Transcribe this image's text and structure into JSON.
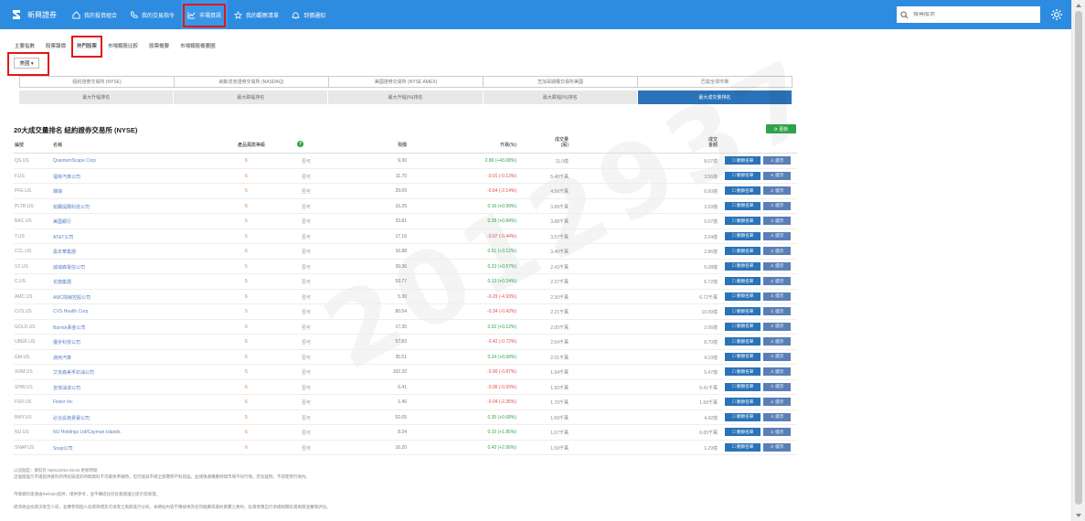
{
  "app": {
    "logo_label": "新興證券"
  },
  "nav": [
    {
      "label": "新興證券",
      "icon": "logo-icon"
    },
    {
      "label": "我的投資組合",
      "icon": "house-icon"
    },
    {
      "label": "我的交易指令",
      "icon": "phone-icon"
    },
    {
      "label": "市場資訊",
      "icon": "chart-icon"
    },
    {
      "label": "我的觀察清單",
      "icon": "star-icon"
    },
    {
      "label": "到價通知",
      "icon": "bell-icon"
    }
  ],
  "search": {
    "placeholder": "搜尋股票"
  },
  "subtabs": [
    "主要指數",
    "股票報價",
    "熱門股票",
    "市場類股比較",
    "股票概要",
    "市場類股概要圖"
  ],
  "market_dropdown": {
    "value": "美國 ▾"
  },
  "exchanges": [
    "紐約證券交易所 (NYSE)",
    "納斯達克證券交易所 (NASDAQ)",
    "美國證券交易所 (NYSE AMEX)",
    "芝加哥期權交易所美國",
    "巴茲全球市場"
  ],
  "ranking_tabs": [
    "最大升幅排名",
    "最大跌幅排名",
    "最大升幅(%)排名",
    "最大跌幅(%)排名",
    "最大成交量排名"
  ],
  "table": {
    "title": "20大成交量排名 紐約證券交易所 (NYSE)",
    "refresh_label": "⟳ 更新",
    "headers": {
      "symbol": "編號",
      "name": "名稱",
      "capital": "產品風險等級",
      "flag": "",
      "price": "現價",
      "change": "升跌(%)",
      "volume": "成交量\n(股)",
      "amount": "成交\n金額"
    },
    "help_icon": "?",
    "watch_label": "☐ 觀察名單",
    "alert_label": "♙ 提示",
    "rows": [
      {
        "symbol": "QS.US",
        "name": "QuantumScape Corp",
        "cap": "6",
        "flag": "否可",
        "price": "9.30",
        "change": "2.80 (+43.08%)",
        "dir": "up",
        "volume": "11.0億",
        "amount": "8.07億"
      },
      {
        "symbol": "F.US",
        "name": "福特汽車公司",
        "cap": "6",
        "flag": "否可",
        "price": "11.70",
        "change": "-0.01 (-0.13%)",
        "dir": "down",
        "volume": "5.48千萬",
        "amount": "3.56億"
      },
      {
        "symbol": "PFE.US",
        "name": "輝瑞",
        "cap": "5",
        "flag": "否可",
        "price": "29.09",
        "change": "-0.64 (-2.14%)",
        "dir": "down",
        "volume": "4.56千萬",
        "amount": "6.60億"
      },
      {
        "symbol": "PLTR.US",
        "name": "帕蘭提爾科技公司",
        "cap": "6",
        "flag": "否可",
        "price": "16.25",
        "change": "0.16 (+0.99%)",
        "dir": "up",
        "volume": "3.89千萬",
        "amount": "3.59億"
      },
      {
        "symbol": "BAC.US",
        "name": "美國銀行",
        "cap": "5",
        "flag": "否可",
        "price": "33.81",
        "change": "0.28 (+0.84%)",
        "dir": "up",
        "volume": "3.88千萬",
        "amount": "6.67億"
      },
      {
        "symbol": "T.US",
        "name": "AT&T公司",
        "cap": "5",
        "flag": "否可",
        "price": "17.16",
        "change": "-0.07 (-0.44%)",
        "dir": "down",
        "volume": "3.57千萬",
        "amount": "3.24億"
      },
      {
        "symbol": "CCL.US",
        "name": "嘉年華集團",
        "cap": "6",
        "flag": "否可",
        "price": "16.88",
        "change": "0.51 (+3.12%)",
        "dir": "up",
        "volume": "3.40千萬",
        "amount": "2.86億"
      },
      {
        "symbol": "VZ.US",
        "name": "威瑞森電信公司",
        "cap": "5",
        "flag": "否可",
        "price": "39.36",
        "change": "0.23 (+0.57%)",
        "dir": "up",
        "volume": "2.43千萬",
        "amount": "5.08億"
      },
      {
        "symbol": "C.US",
        "name": "花旗集團",
        "cap": "5",
        "flag": "否可",
        "price": "53.77",
        "change": "0.13 (+0.24%)",
        "dir": "up",
        "volume": "2.37千萬",
        "amount": "6.72億"
      },
      {
        "symbol": "AMC.US",
        "name": "AMC院線控股公司",
        "cap": "6",
        "flag": "否可",
        "price": "5.30",
        "change": "-0.29 (-4.93%)",
        "dir": "down",
        "volume": "2.30千萬",
        "amount": "6.72千萬"
      },
      {
        "symbol": "CVS.US",
        "name": "CVS Health Corp",
        "cap": "5",
        "flag": "否可",
        "price": "80.54",
        "change": "-0.34 (-0.42%)",
        "dir": "down",
        "volume": "2.21千萬",
        "amount": "10.99億"
      },
      {
        "symbol": "GOLD.US",
        "name": "Barrick黃金公司",
        "cap": "6",
        "flag": "否可",
        "price": "17.35",
        "change": "0.02 (+0.12%)",
        "dir": "up",
        "volume": "2.05千萬",
        "amount": "2.06億"
      },
      {
        "symbol": "UBER.US",
        "name": "優步科技公司",
        "cap": "6",
        "flag": "否可",
        "price": "57.83",
        "change": "-0.42 (-0.72%)",
        "dir": "down",
        "volume": "2.04千萬",
        "amount": "8.70億"
      },
      {
        "symbol": "GM.US",
        "name": "通用汽車",
        "cap": "6",
        "flag": "否可",
        "price": "35.51",
        "change": "0.24 (+0.68%)",
        "dir": "up",
        "volume": "2.01千萬",
        "amount": "4.10億"
      },
      {
        "symbol": "XOM.US",
        "name": "艾克森美孚石油公司",
        "cap": "5",
        "flag": "否可",
        "price": "102.32",
        "change": "-0.90 (-0.87%)",
        "dir": "down",
        "volume": "1.94千萬",
        "amount": "5.47億"
      },
      {
        "symbol": "SHW.US",
        "name": "宣偉油漆公司",
        "cap": "6",
        "flag": "否可",
        "price": "6.41",
        "change": "-0.06 (-0.93%)",
        "dir": "down",
        "volume": "1.93千萬",
        "amount": "6.41千萬"
      },
      {
        "symbol": "FSR.US",
        "name": "Fisker Inc",
        "cap": "6",
        "flag": "否可",
        "price": "1.46",
        "change": "-0.04 (-2.35%)",
        "dir": "down",
        "volume": "1.70千萬",
        "amount": "1.50千萬"
      },
      {
        "symbol": "BMY.US",
        "name": "必治妥施貴寶公司",
        "cap": "5",
        "flag": "否可",
        "price": "52.05",
        "change": "0.35 (+0.68%)",
        "dir": "up",
        "volume": "1.69千萬",
        "amount": "4.42億"
      },
      {
        "symbol": "NU.US",
        "name": "NU Holdings Ltd/Cayman Islands",
        "cap": "6",
        "flag": "否可",
        "price": "8.24",
        "change": "0.15 (+1.85%)",
        "dir": "up",
        "volume": "1.67千萬",
        "amount": "6.65千萬"
      },
      {
        "symbol": "SNAP.US",
        "name": "Snap公司",
        "cap": "6",
        "flag": "否可",
        "price": "16.20",
        "change": "0.42 (+2.66%)",
        "dir": "up",
        "volume": "1.59千萬",
        "amount": "1.29億"
      }
    ]
  },
  "footnotes": [
    "以這個是：資料於 05/01/2024 05:00 更新時間",
    "這個版面乃市場提供資料所用紀錄進的時間資料不可確保準確時，但可能與市場全部實際不對錯誤，並謹慎選購應時間市場不同行情。若有疑問，不得使用行情內。",
    "市場資料來源由Refinitiv提供，僅供參考，並不構成任何投資建議之提示或保證。",
    "經濟收益投資決策至少前，並應參照個人投資目標及可承受之風險進行分析。本網站內容不應被視為任何推薦或邀約買賣之要約，投資者應自行承擔相關投資風險並審慎評估。"
  ],
  "watermark": "2012937"
}
